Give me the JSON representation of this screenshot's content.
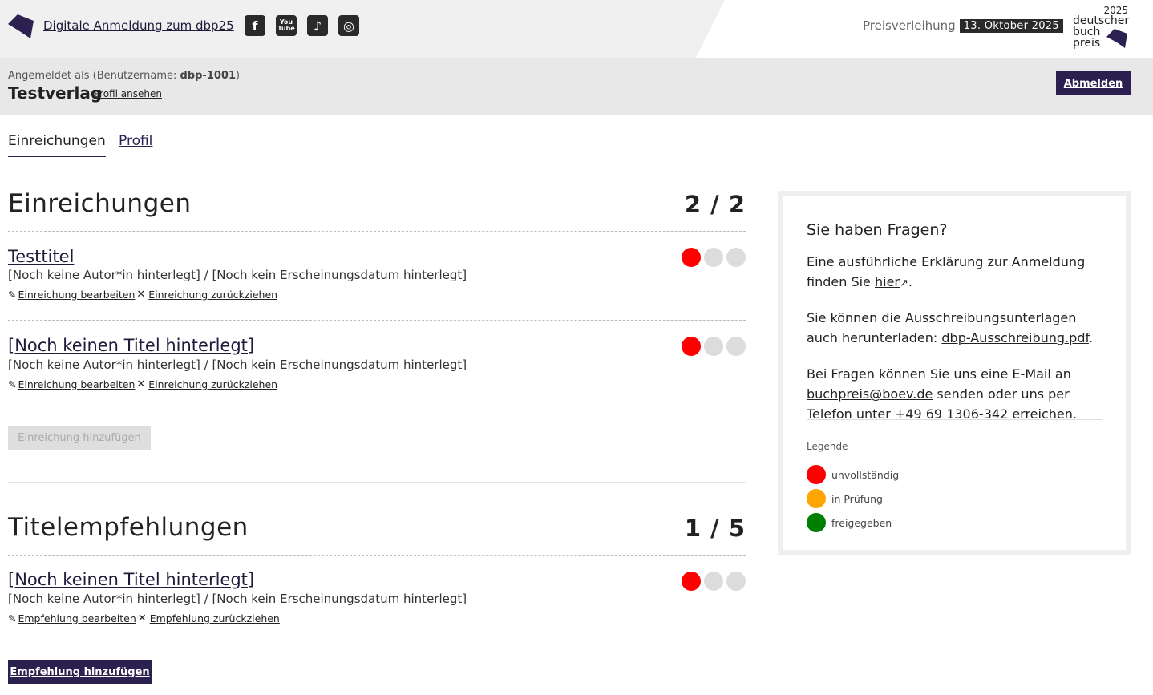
{
  "header": {
    "registration_link": "Digitale Anmeldung zum dbp25",
    "social": [
      "facebook-icon",
      "youtube-icon",
      "tiktok-icon",
      "instagram-icon"
    ],
    "prize_label": "Preisverleihung",
    "prize_date": "13. Oktober 2025",
    "brand": {
      "year": "2025",
      "line1": "deutscher",
      "line2": "buch",
      "line3": "preis"
    }
  },
  "login": {
    "prefix": "Angemeldet als (Benutzername: ",
    "username": "dbp-1001",
    "suffix": ")",
    "publisher": "Testverlag",
    "profile_link": "Profil ansehen",
    "logout": "Abmelden"
  },
  "tabs": [
    {
      "label": "Einreichungen",
      "active": true
    },
    {
      "label": "Profil",
      "active": false
    }
  ],
  "submissions": {
    "title": "Einreichungen",
    "count": "2 / 2",
    "items": [
      {
        "title": "Testtitel",
        "meta": "[Noch keine Autor*in hinterlegt] / [Noch kein Erscheinungsdatum hinterlegt]",
        "edit": "Einreichung bearbeiten",
        "withdraw": "Einreichung zurückziehen"
      },
      {
        "title": "[Noch keinen Titel hinterlegt]",
        "meta": "[Noch keine Autor*in hinterlegt] / [Noch kein Erscheinungsdatum hinterlegt]",
        "edit": "Einreichung bearbeiten",
        "withdraw": "Einreichung zurückziehen"
      }
    ],
    "add_button": "Einreichung hinzufügen"
  },
  "recommendations": {
    "title": "Titelempfehlungen",
    "count": "1 / 5",
    "items": [
      {
        "title": "[Noch keinen Titel hinterlegt]",
        "meta": "[Noch keine Autor*in hinterlegt] / [Noch kein Erscheinungsdatum hinterlegt]",
        "edit": "Empfehlung bearbeiten",
        "withdraw": "Empfehlung zurückziehen"
      }
    ],
    "add_button": "Empfehlung hinzufügen"
  },
  "sidebar": {
    "heading": "Sie haben Fragen?",
    "p1_a": "Eine ausführliche Erklärung zur Anmeldung finden Sie ",
    "p1_link": "hier",
    "p1_b": ".",
    "p2_a": "Sie können die Ausschreibungsunterlagen auch herunterladen: ",
    "p2_link": "dbp-Ausschreibung.pdf",
    "p2_b": ".",
    "p3_a": "Bei Fragen können Sie uns eine E-Mail an ",
    "p3_link": "buchpreis@boev.de",
    "p3_b": " senden oder uns per Telefon unter +49 69 1306-342 erreichen.",
    "legend_title": "Legende",
    "legend": [
      {
        "label": "unvollständig",
        "color": "#ff0000"
      },
      {
        "label": "in Prüfung",
        "color": "#ffa500"
      },
      {
        "label": "freigegeben",
        "color": "#008000"
      }
    ]
  },
  "colors": {
    "primary": "#2b2050",
    "status_red": "#ff0000",
    "status_empty": "#dcdcdc"
  }
}
